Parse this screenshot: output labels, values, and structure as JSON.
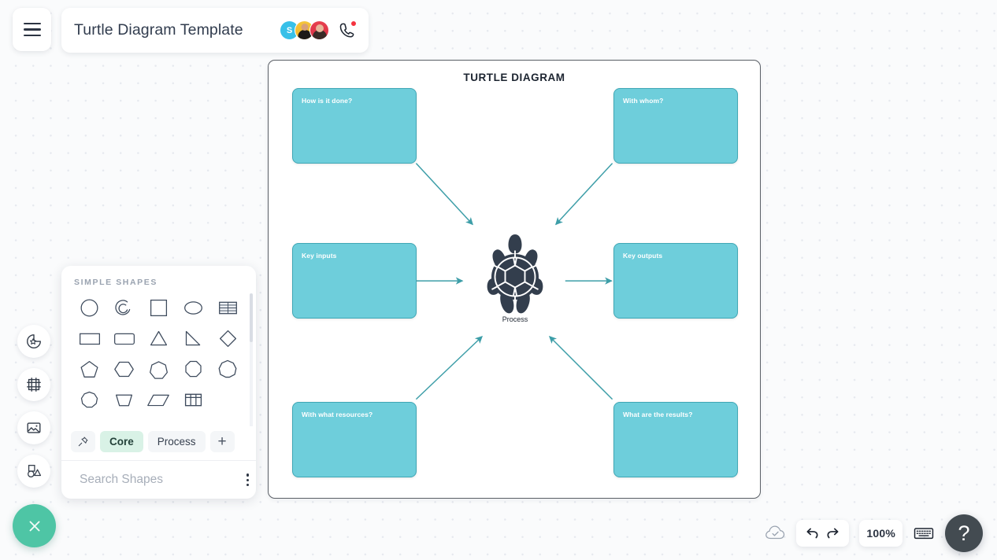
{
  "header": {
    "menu_icon": "hamburger-menu-icon",
    "doc_title": "Turtle Diagram Template",
    "avatars": [
      {
        "initial": "S",
        "kind": "initial",
        "color": "#37c0e8"
      },
      {
        "initial": "",
        "kind": "photo",
        "color": "#f0b429"
      },
      {
        "initial": "",
        "kind": "photo",
        "color": "#d92e44"
      }
    ],
    "call_icon": "phone-call-icon",
    "call_badge": true
  },
  "rail": {
    "items": [
      {
        "icon": "sticker-shapes-icon",
        "name": "sticker"
      },
      {
        "icon": "frame-icon",
        "name": "frame"
      },
      {
        "icon": "image-icon",
        "name": "image"
      },
      {
        "icon": "shapes-icon",
        "name": "shapes"
      }
    ]
  },
  "shapes_panel": {
    "title": "SIMPLE SHAPES",
    "shapes": [
      "circle",
      "arc-spiral",
      "square",
      "ellipse",
      "table-lined",
      "rectangle",
      "rounded-rectangle",
      "triangle",
      "right-triangle",
      "diamond",
      "pentagon",
      "hexagon",
      "heptagon",
      "octagon",
      "nonagon",
      "decagon",
      "trapezoid",
      "parallelogram",
      "table-grid"
    ],
    "tabs": [
      {
        "label": "",
        "icon": "pin-icon",
        "active": false
      },
      {
        "label": "Core",
        "icon": "",
        "active": true
      },
      {
        "label": "Process",
        "icon": "",
        "active": false
      },
      {
        "label": "+",
        "icon": "plus-icon",
        "active": false
      }
    ],
    "search": {
      "icon": "search-icon",
      "placeholder": "Search Shapes",
      "value": "",
      "menu_icon": "kebab-menu-icon"
    }
  },
  "diagram": {
    "title": "TURTLE DIAGRAM",
    "center": {
      "icon": "turtle-icon",
      "label": "Process"
    },
    "node_fill": "#6ecedb",
    "node_stroke": "#3fa7b5",
    "connector_color": "#3d9ea8",
    "nodes": [
      {
        "id": "top-left",
        "label": "How is it done?"
      },
      {
        "id": "top-right",
        "label": "With whom?"
      },
      {
        "id": "middle-left",
        "label": "Key inputs"
      },
      {
        "id": "middle-right",
        "label": "Key outputs"
      },
      {
        "id": "bottom-left",
        "label": "With what resources?"
      },
      {
        "id": "bottom-right",
        "label": "What are the results?"
      }
    ]
  },
  "footer": {
    "close_icon": "close-x-icon",
    "save_status_icon": "cloud-check-icon",
    "undo_icon": "undo-icon",
    "redo_icon": "redo-icon",
    "zoom_level": "100%",
    "keyboard_icon": "keyboard-icon",
    "help_label": "?"
  }
}
